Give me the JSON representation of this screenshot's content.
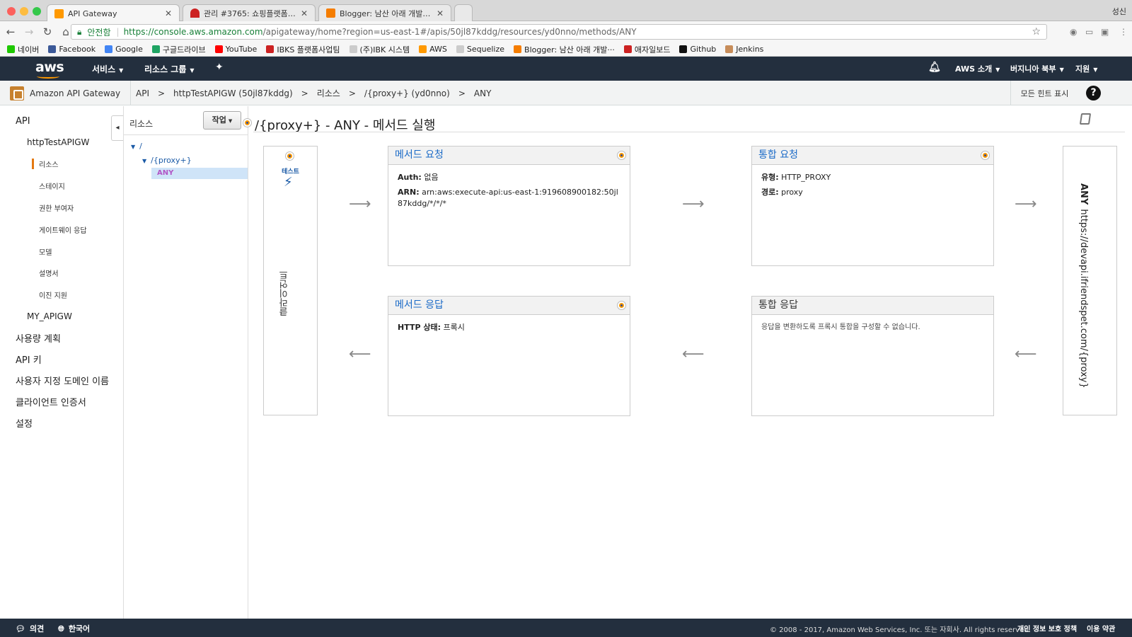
{
  "browser": {
    "tabs": [
      {
        "title": "API Gateway",
        "active": true,
        "color": "#ff9900"
      },
      {
        "title": "관리 #3765: 쇼핑플랫폼 API Gate",
        "active": false,
        "color": "#cc2222"
      },
      {
        "title": "Blogger: 남산 아래 개발자들 - 모든",
        "active": false,
        "color": "#f57d00"
      }
    ],
    "profile": "성신",
    "url_secure_label": "안전함",
    "url_host": "https://console.aws.amazon.com",
    "url_path": "/apigateway/home?region=us-east-1#/apis/50jl87kddg/resources/yd0nno/methods/ANY",
    "bookmarks": [
      {
        "label": "네이버",
        "color": "#1ec800"
      },
      {
        "label": "Facebook",
        "color": "#3b5998"
      },
      {
        "label": "Google",
        "color": "#4285f4"
      },
      {
        "label": "구글드라이브",
        "color": "#1fa463"
      },
      {
        "label": "YouTube",
        "color": "#ff0000"
      },
      {
        "label": "IBKS 플랫폼사업팀",
        "color": "#cc2222"
      },
      {
        "label": "(주)IBK 시스템",
        "color": "#cccccc"
      },
      {
        "label": "AWS",
        "color": "#ff9900"
      },
      {
        "label": "Sequelize",
        "color": "#cccccc"
      },
      {
        "label": "Blogger: 남산 아래 개발···",
        "color": "#f57d00"
      },
      {
        "label": "애자일보드",
        "color": "#cc2222"
      },
      {
        "label": "Github",
        "color": "#111111"
      },
      {
        "label": "Jenkins",
        "color": "#c78d5a"
      }
    ]
  },
  "aws_header": {
    "logo": "aws",
    "services": "서비스",
    "resource_groups": "리소스 그룹",
    "account": "AWS 소개",
    "region": "버지니아 북부",
    "support": "지원"
  },
  "breadcrumb": {
    "service": "Amazon API Gateway",
    "items": [
      "API",
      ">",
      "httpTestAPIGW (50jl87kddg)",
      ">",
      "리소스",
      ">",
      "/{proxy+} (yd0nno)",
      ">",
      "ANY"
    ],
    "hints": "모든 힌트 표시",
    "help": "?"
  },
  "sidebar": {
    "api": "API",
    "api_name": "httpTestAPIGW",
    "sub": [
      "리소스",
      "스테이지",
      "권한 부여자",
      "게이트웨이 응답",
      "모델",
      "설명서",
      "이진 지원"
    ],
    "api2": "MY_APIGW",
    "bottom": [
      "사용량 계획",
      "API 키",
      "사용자 지정 도메인 이름",
      "클라이언트 인증서",
      "설정"
    ],
    "collapse": "◂"
  },
  "tree": {
    "header": "리소스",
    "actions": "작업",
    "root": "/",
    "proxy": "/{proxy+}",
    "method": "ANY"
  },
  "main": {
    "title": "/{proxy+} - ANY - 메서드 실행",
    "client": {
      "test": "테스트",
      "label": "클라이언트"
    },
    "method_request": {
      "title": "메서드 요청",
      "auth_label": "Auth:",
      "auth_value": "없음",
      "arn_label": "ARN:",
      "arn_value": "arn:aws:execute-api:us-east-1:919608900182:50jl87kddg/*/*/*"
    },
    "integration_request": {
      "title": "통합 요청",
      "type_label": "유형:",
      "type_value": "HTTP_PROXY",
      "path_label": "경로:",
      "path_value": "proxy"
    },
    "method_response": {
      "title": "메서드 응답",
      "status_label": "HTTP 상태:",
      "status_value": "프록시"
    },
    "integration_response": {
      "title": "통합 응답",
      "note": "응답을 변환하도록 프록시 통합을 구성할 수 없습니다."
    },
    "backend": {
      "method": "ANY",
      "url": "https://devapi.ifriendspet.com/{proxy}"
    }
  },
  "footer": {
    "feedback": "의견",
    "language": "한국어",
    "copyright": "© 2008 - 2017, Amazon Web Services, Inc. 또는 자회사. All rights reserved.",
    "privacy": "개인 정보 보호 정책",
    "terms": "이용 약관"
  }
}
